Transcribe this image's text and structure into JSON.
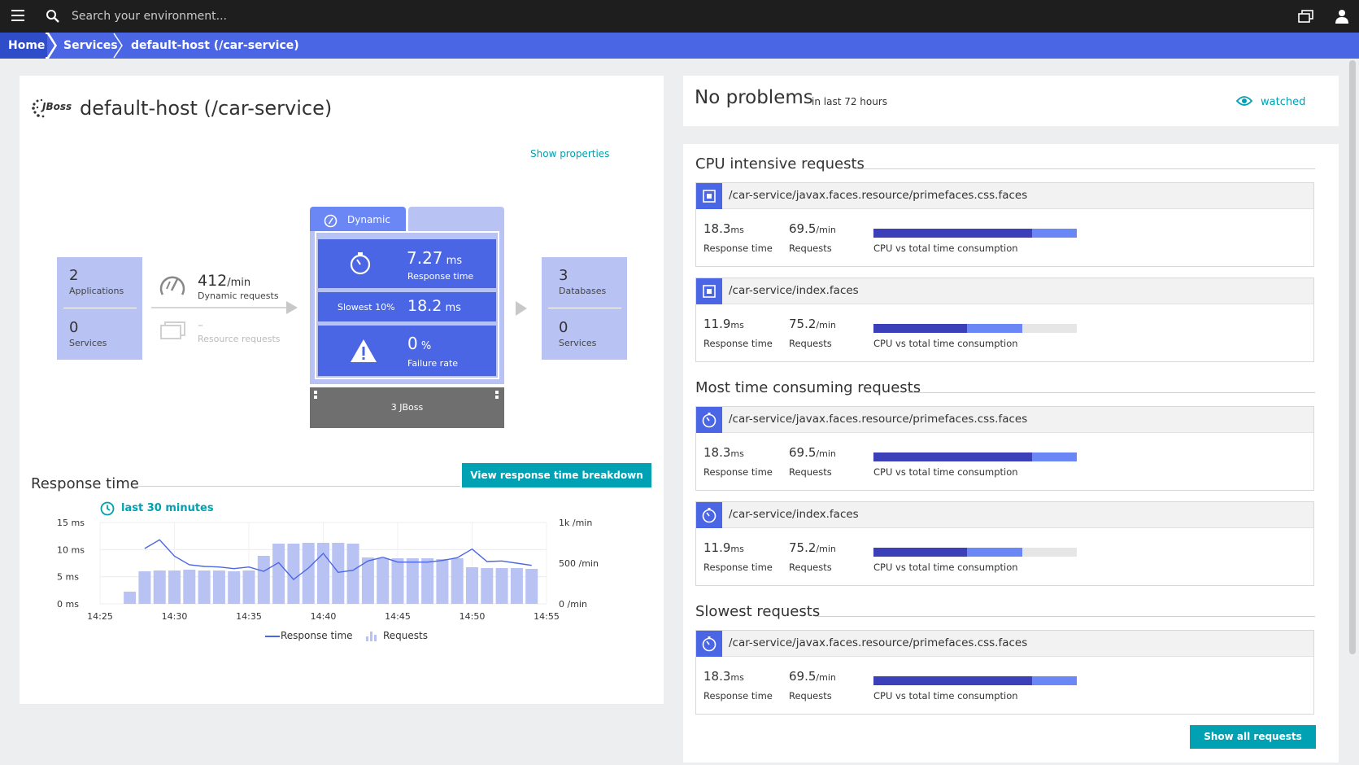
{
  "topbar": {
    "search_placeholder": "Search your environment..."
  },
  "breadcrumb": [
    "Home",
    "Services",
    "default-host (/car-service)"
  ],
  "service": {
    "title": "default-host (/car-service)",
    "logo_text": "JBoss",
    "show_properties": "Show properties"
  },
  "flow": {
    "callers": {
      "apps_count": "2",
      "apps_label": "Applications",
      "services_count": "0",
      "services_label": "Services"
    },
    "dynamic": {
      "rate": "412",
      "unit": "/min",
      "label": "Dynamic requests"
    },
    "resource": {
      "rate": "–",
      "label": "Resource requests"
    },
    "tab_dynamic": "Dynamic",
    "response_time": {
      "value": "7.27",
      "unit": "ms",
      "label": "Response time"
    },
    "slowest": {
      "label": "Slowest 10%",
      "value": "18.2",
      "unit": "ms"
    },
    "failure": {
      "value": "0",
      "unit": "%",
      "label": "Failure rate"
    },
    "process": "3 JBoss",
    "callees": {
      "db_count": "3",
      "db_label": "Databases",
      "services_count": "0",
      "services_label": "Services"
    }
  },
  "response_section": {
    "title": "Response time",
    "breakdown_button": "View response time breakdown",
    "timeframe": "last 30 minutes"
  },
  "chart_data": {
    "type": "bar",
    "x": [
      "14:27",
      "14:28",
      "14:29",
      "14:30",
      "14:31",
      "14:32",
      "14:33",
      "14:34",
      "14:35",
      "14:36",
      "14:37",
      "14:38",
      "14:39",
      "14:40",
      "14:41",
      "14:42",
      "14:43",
      "14:44",
      "14:45",
      "14:46",
      "14:47",
      "14:48",
      "14:49",
      "14:50",
      "14:51",
      "14:52",
      "14:53",
      "14:54"
    ],
    "x_ticks": [
      "14:25",
      "14:30",
      "14:35",
      "14:40",
      "14:45",
      "14:50",
      "14:55"
    ],
    "series": [
      {
        "name": "Requests",
        "type": "bar",
        "axis": "right",
        "values": [
          150,
          400,
          410,
          410,
          420,
          410,
          410,
          400,
          410,
          590,
          740,
          740,
          750,
          750,
          750,
          740,
          570,
          560,
          560,
          560,
          560,
          550,
          560,
          450,
          440,
          440,
          440,
          430
        ]
      },
      {
        "name": "Response time",
        "type": "line",
        "axis": "left",
        "values": [
          null,
          10.2,
          11.8,
          8.8,
          7.2,
          6.9,
          6.8,
          6.5,
          6.8,
          6.0,
          7.6,
          4.5,
          6.6,
          9.3,
          5.8,
          6.2,
          7.9,
          8.6,
          7.7,
          7.7,
          7.7,
          8.0,
          8.5,
          10.1,
          7.8,
          7.9,
          7.5,
          7.1
        ]
      }
    ],
    "y_left": {
      "ticks": [
        "15 ms",
        "10 ms",
        "5 ms",
        "0 ms"
      ],
      "range": [
        0,
        15
      ]
    },
    "y_right": {
      "ticks": [
        "1k /min",
        "500 /min",
        "0 /min"
      ],
      "range": [
        0,
        1000
      ]
    },
    "legend": [
      "Response time",
      "Requests"
    ],
    "legend_position": "bottom",
    "colors": {
      "bar": "#b9c3f3",
      "line": "#4a66e4"
    }
  },
  "problems": {
    "title": "No problems",
    "subtitle": "in last 72 hours",
    "watched": "watched"
  },
  "requests": {
    "sections": [
      {
        "title": "CPU intensive requests",
        "icon": "cpu-icon",
        "items": [
          {
            "name": "/car-service/javax.faces.resource/primefaces.css.faces",
            "rt": "18.3",
            "rt_unit": "ms",
            "rate": "69.5",
            "rate_unit": "/min",
            "cpu_pct": 78,
            "total_pct": 100
          },
          {
            "name": "/car-service/index.faces",
            "rt": "11.9",
            "rt_unit": "ms",
            "rate": "75.2",
            "rate_unit": "/min",
            "cpu_pct": 46,
            "total_pct": 73
          }
        ]
      },
      {
        "title": "Most time consuming requests",
        "icon": "clock-icon",
        "items": [
          {
            "name": "/car-service/javax.faces.resource/primefaces.css.faces",
            "rt": "18.3",
            "rt_unit": "ms",
            "rate": "69.5",
            "rate_unit": "/min",
            "cpu_pct": 78,
            "total_pct": 100
          },
          {
            "name": "/car-service/index.faces",
            "rt": "11.9",
            "rt_unit": "ms",
            "rate": "75.2",
            "rate_unit": "/min",
            "cpu_pct": 46,
            "total_pct": 73
          }
        ]
      },
      {
        "title": "Slowest requests",
        "icon": "clock-icon",
        "items": [
          {
            "name": "/car-service/javax.faces.resource/primefaces.css.faces",
            "rt": "18.3",
            "rt_unit": "ms",
            "rate": "69.5",
            "rate_unit": "/min",
            "cpu_pct": 78,
            "total_pct": 100
          }
        ]
      }
    ],
    "labels": {
      "rt": "Response time",
      "rate": "Requests",
      "cpu": "CPU vs total time consumption"
    },
    "show_all": "Show all requests"
  }
}
